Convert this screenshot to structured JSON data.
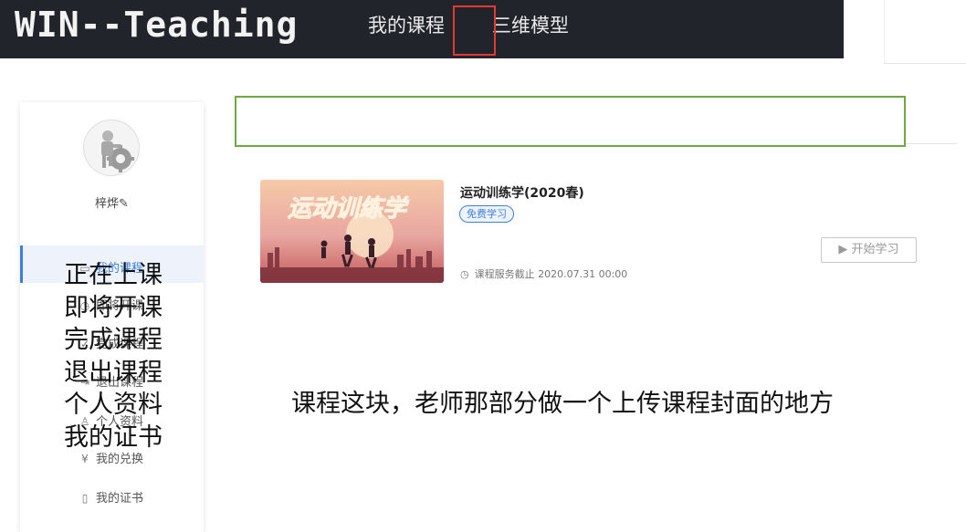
{
  "header": {
    "logo": "WIN--Teaching",
    "nav": [
      "我的课程",
      "三维模型"
    ]
  },
  "sidebar": {
    "username": "梓烨",
    "menu": [
      {
        "label": "我的课程",
        "icon": "book-icon",
        "active": true
      },
      {
        "label": "即将开课",
        "icon": "clock-icon",
        "active": false
      },
      {
        "label": "完成课程",
        "icon": "check-icon",
        "active": false
      },
      {
        "label": "退出课程",
        "icon": "exit-icon",
        "active": false
      },
      {
        "label": "个人资料",
        "icon": "user-icon",
        "active": false
      },
      {
        "label": "我的兑换",
        "icon": "yen-icon",
        "active": false
      },
      {
        "label": "我的证书",
        "icon": "certificate-icon",
        "active": false
      }
    ]
  },
  "overlay_lines": [
    "正在上课",
    "即将开课",
    "完成课程",
    "退出课程",
    "个人资料",
    "我的证书"
  ],
  "course": {
    "cover_text": "运动训练学",
    "title": "运动训练学(2020春)",
    "tag": "免费学习",
    "service": "课程服务截止 2020.07.31 00:00",
    "button": "▶ 开始学习"
  },
  "annotation": "课程这块，老师那部分做一个上传课程封面的地方",
  "colors": {
    "accent": "#3d7fe0",
    "header_bg": "#22242b",
    "red_highlight": "#e23a2e",
    "green_highlight": "#6ea843"
  }
}
